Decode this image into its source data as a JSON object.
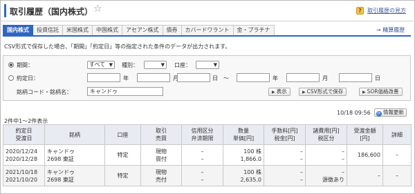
{
  "header": {
    "title": "取引履歴（国内株式）",
    "help_icon_text": "?",
    "help_link": "取引履歴の見方"
  },
  "tabs": [
    {
      "label": "国内株式",
      "active": true
    },
    {
      "label": "投資信託"
    },
    {
      "label": "米国株式"
    },
    {
      "label": "中国株式"
    },
    {
      "label": "アセアン株式"
    },
    {
      "label": "債券"
    },
    {
      "label": "カバードワラント"
    },
    {
      "label": "金・プラチナ"
    }
  ],
  "calc_link": "→ 精算履歴",
  "note": "CSV形式で保存した場合、「期間」「約定日」等の指定された条件のデータが出力されます。",
  "search": {
    "period_label": "期間：",
    "period_value": "すべて",
    "type_label": "種別：",
    "type_value": "",
    "account_label": "口座：",
    "account_value": "",
    "date_label": "約定日：",
    "year": "年",
    "month": "月",
    "day": "日",
    "tilde": "〜",
    "code_label": "銘柄コード・銘柄名：",
    "code_value": "キャンドゥ",
    "btn_show": "表示",
    "btn_csv": "CSV形式で保存",
    "btn_sor": "SOR価格改善"
  },
  "result_count": "2件中1〜2件表示",
  "timestamp": "10/18 09:56",
  "refresh_label": "情報更新",
  "table": {
    "headers": {
      "date1": "約定日",
      "date2": "受渡日",
      "stock": "銘柄",
      "account": "口座",
      "trade1": "取引",
      "trade2": "売買",
      "credit1": "信用区分",
      "credit2": "弁済期限",
      "qty1": "数量",
      "qty2": "単価[円]",
      "fee1": "手数料[円]",
      "fee2": "税金[円]",
      "cost1": "諸費用[円]",
      "cost2": "税区分",
      "amount1": "受渡金額",
      "amount2": "[円]",
      "detail": "詳細"
    },
    "rows": [
      {
        "date1": "2020/12/24",
        "date2": "2020/12/28",
        "name": "キャンドゥ",
        "code": "2698 東証",
        "account": "特定",
        "trade1": "現物",
        "trade2": "買付",
        "credit1": "–",
        "credit2": "–",
        "qty": "100 株",
        "price": "1,866.0",
        "fee": "–",
        "tax": "–",
        "cost": "–",
        "taxcat": "–",
        "amount": "186,600",
        "detail": "–"
      },
      {
        "date1": "2021/10/18",
        "date2": "2021/10/20",
        "name": "キャンドゥ",
        "code": "2698 東証",
        "account": "特定",
        "trade1": "現物",
        "trade2": "売付",
        "credit1": "–",
        "credit2": "–",
        "qty": "100 株",
        "price": "2,635.0",
        "fee": "–",
        "tax": "–",
        "cost": "–",
        "taxcat": "源徴あり",
        "amount": "–",
        "detail": "–"
      }
    ]
  }
}
